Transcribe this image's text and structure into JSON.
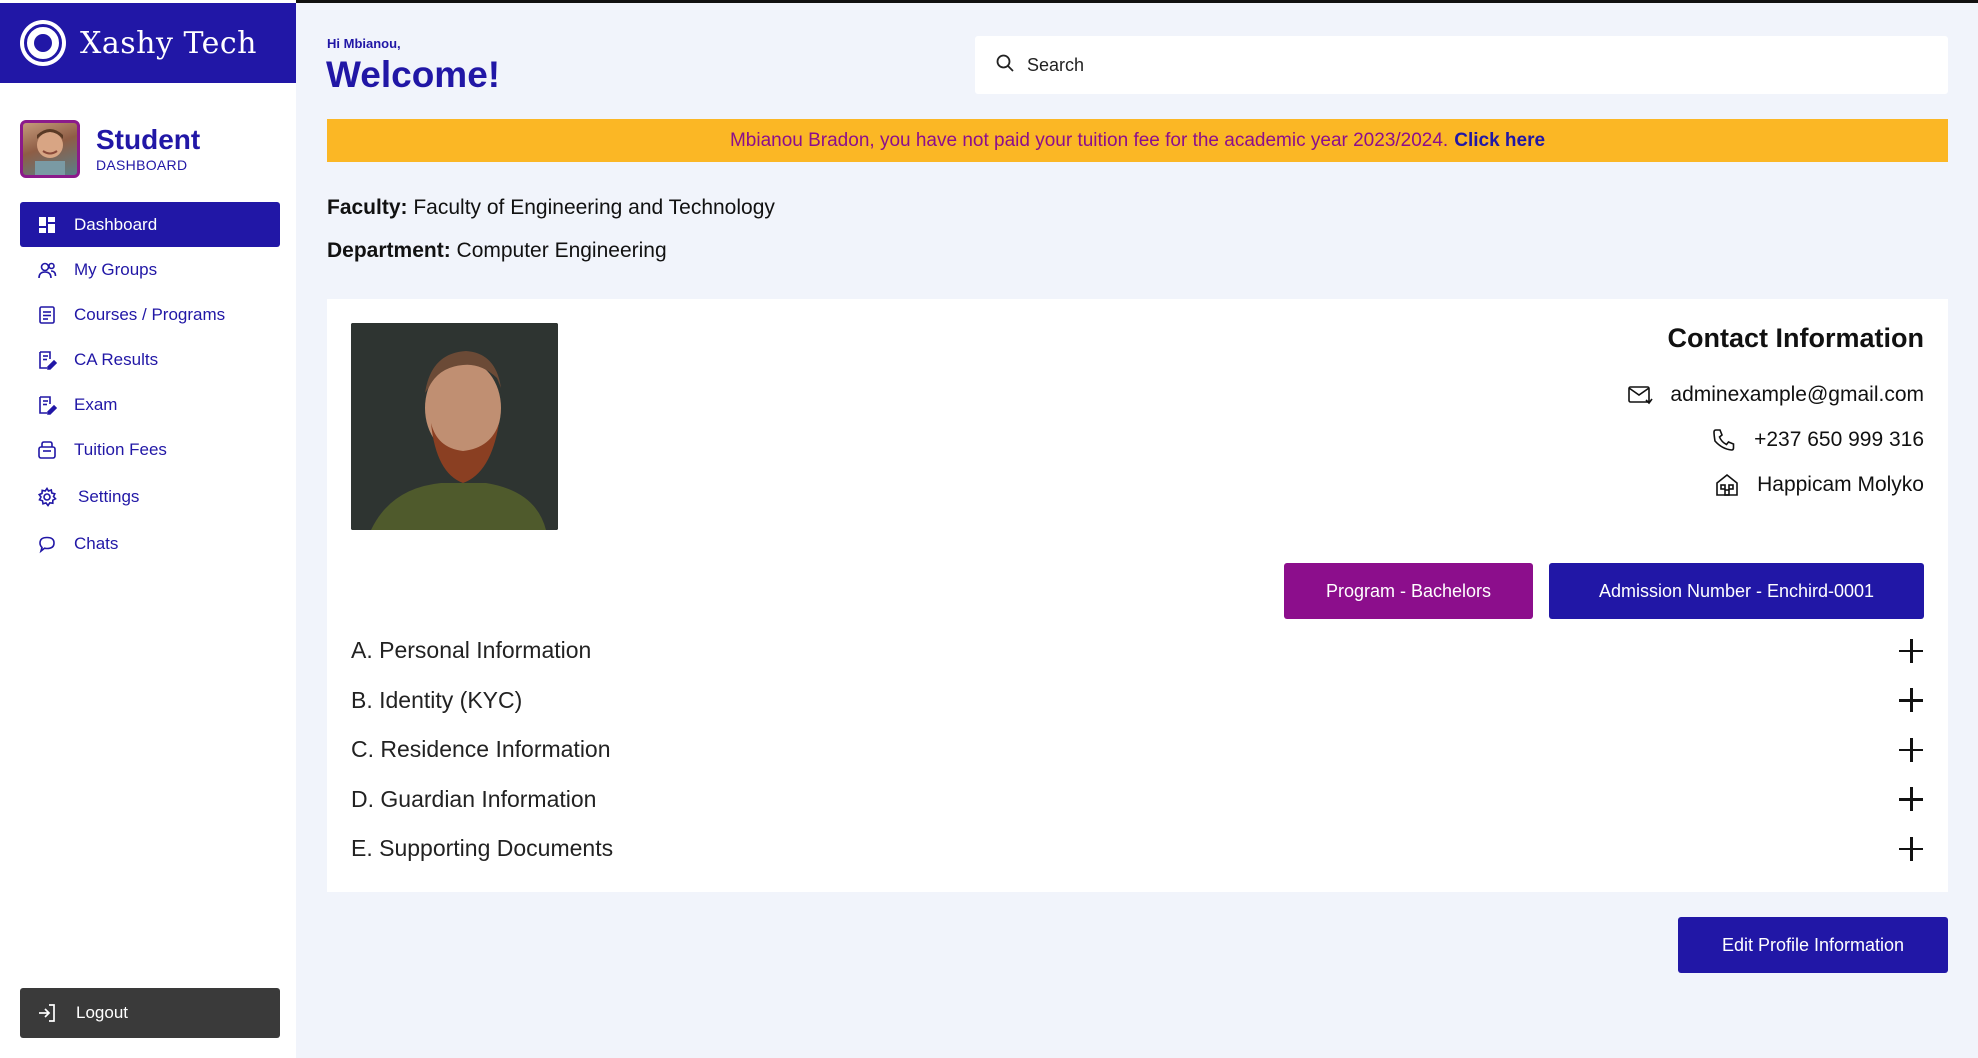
{
  "brand": {
    "name": "Xashy Tech"
  },
  "profile": {
    "role": "Student",
    "subtitle": "DASHBOARD"
  },
  "sidebar": {
    "items": [
      {
        "label": "Dashboard",
        "icon": "grid-icon",
        "active": true
      },
      {
        "label": "My Groups",
        "icon": "users-icon"
      },
      {
        "label": "Courses / Programs",
        "icon": "list-icon"
      },
      {
        "label": "CA Results",
        "icon": "doc-edit-icon"
      },
      {
        "label": "Exam",
        "icon": "doc-edit-icon"
      },
      {
        "label": "Tuition Fees",
        "icon": "wallet-icon"
      },
      {
        "label": "Settings",
        "icon": "gear-icon"
      },
      {
        "label": "Chats",
        "icon": "chat-icon"
      }
    ],
    "logout_label": "Logout"
  },
  "header": {
    "greeting_small": "Hi Mbianou,",
    "greeting_big": "Welcome!"
  },
  "search": {
    "placeholder": "Search",
    "value": ""
  },
  "banner": {
    "message": "Mbianou Bradon, you have not paid your tuition fee for the academic year 2023/2024.",
    "cta": "Click here"
  },
  "academic": {
    "faculty_label": "Faculty:",
    "faculty_value": "Faculty of Engineering and Technology",
    "department_label": "Department:",
    "department_value": "Computer Engineering"
  },
  "contact": {
    "title": "Contact Information",
    "email": "adminexample@gmail.com",
    "phone": "+237 650 999 316",
    "address": "Happicam Molyko"
  },
  "badges": {
    "program": "Program - Bachelors",
    "admission": "Admission Number - Enchird-0001"
  },
  "sections": [
    "A. Personal Information",
    "B. Identity (KYC)",
    "C. Residence Information",
    "D. Guardian Information",
    "E. Supporting Documents"
  ],
  "actions": {
    "edit_profile": "Edit Profile Information"
  },
  "colors": {
    "primary": "#2117a6",
    "accent": "#8c0e8c",
    "warning": "#fbb725"
  }
}
